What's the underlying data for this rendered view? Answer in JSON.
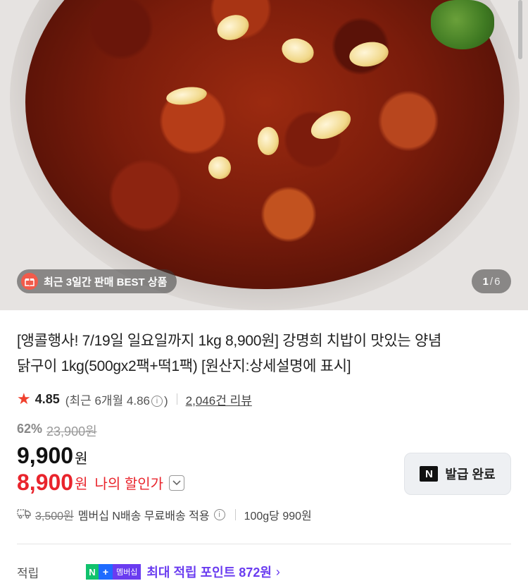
{
  "hero": {
    "badge_label": "최근 3일간 판매 BEST 상품",
    "page_current": "1",
    "page_separator": "/",
    "page_total": "6"
  },
  "product": {
    "title_line1": "[앵콜행사! 7/19일 일요일까지 1kg 8,900원] 강명희 치밥이 맛있는 양념",
    "title_line2": "닭구이 1kg(500gx2팩+떡1팩) [원산지:상세설명에 표시]"
  },
  "rating": {
    "value": "4.85",
    "recent_prefix": "(최근 6개월 4.86",
    "recent_suffix": ")",
    "info_glyph": "i",
    "reviews": "2,046건 리뷰"
  },
  "price": {
    "discount_rate": "62%",
    "original": "23,900원",
    "sale_number": "9,900",
    "sale_unit": "원",
    "my_number": "8,900",
    "my_unit": "원",
    "my_label": "나의 할인가"
  },
  "coupon": {
    "icon_letter": "N",
    "label": "발급 완료"
  },
  "delivery": {
    "original_fee": "3,500원",
    "text": "멤버십 N배송 무료배송 적용",
    "info_glyph": "i",
    "unit_price": "100g당 990원"
  },
  "points": {
    "label": "적립",
    "badge_n": "N",
    "badge_plus": "+",
    "badge_text": "멤버십",
    "text": "최대 적립 포인트 872원",
    "arrow": "›"
  },
  "colors": {
    "accent_red": "#e9242c",
    "points_purple": "#6a3cf0",
    "star": "#f0412e"
  },
  "icons": [
    "gift-icon",
    "star-icon",
    "info-icon",
    "chevron-down-icon",
    "n-icon",
    "truck-icon",
    "chevron-right-icon"
  ]
}
